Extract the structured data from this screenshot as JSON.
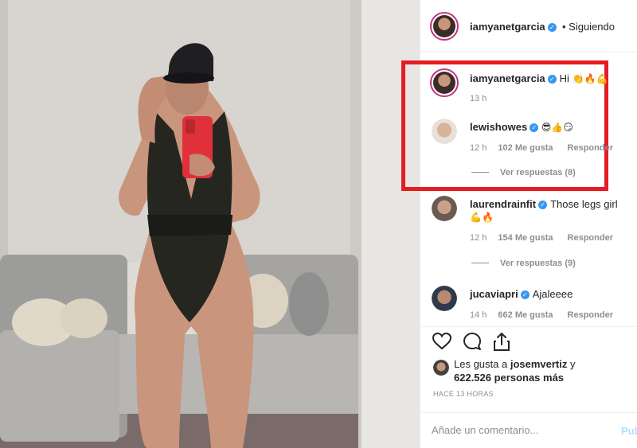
{
  "post_author": {
    "username": "iamyanetgarcia",
    "follow_status": "• Siguiendo"
  },
  "comments": [
    {
      "username": "iamyanetgarcia",
      "text": "Hi",
      "emoji": "👏🔥💪",
      "time": "13 h"
    },
    {
      "username": "lewishowes",
      "text": "",
      "emoji": "😎👍😏",
      "time": "12 h",
      "likes": "102 Me gusta",
      "reply_label": "Responder",
      "view_replies": "Ver respuestas (8)"
    },
    {
      "username": "laurendrainfit",
      "text": "Those legs girl",
      "emoji": "💪🔥",
      "time": "12 h",
      "likes": "154 Me gusta",
      "reply_label": "Responder",
      "view_replies": "Ver respuestas (9)"
    },
    {
      "username": "jucaviapri",
      "text": "Ajaleeee",
      "time": "14 h",
      "likes": "662 Me gusta",
      "reply_label": "Responder"
    }
  ],
  "icons": {
    "like": "heart-icon",
    "comment": "comment-icon",
    "share": "share-icon",
    "verified": "verified-badge-icon"
  },
  "likes_summary": {
    "prefix": "Les gusta a",
    "user": "josemvertiz",
    "suffix": "y",
    "others": "622.526 personas más"
  },
  "posted_ago": "HACE 13 HORAS",
  "add_comment": {
    "placeholder": "Añade un comentario...",
    "publish_label": "Publicar"
  },
  "colors": {
    "highlight_border": "#e51c23",
    "verified_blue": "#3897f0",
    "meta_gray": "#8e8e8e",
    "phone_case": "#e0303a"
  }
}
